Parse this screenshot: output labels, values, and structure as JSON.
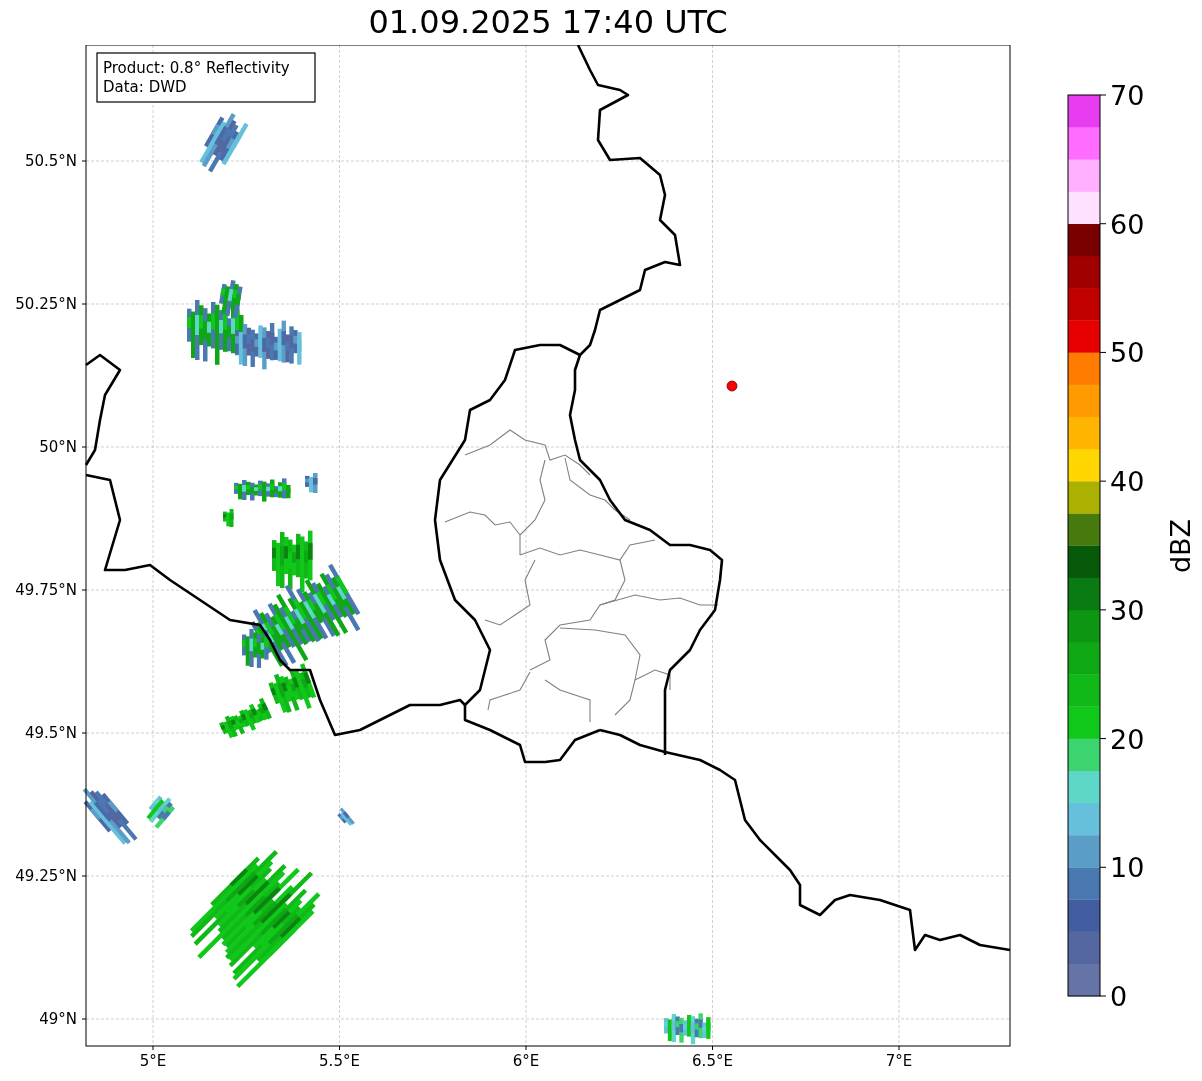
{
  "title": "01.09.2025 17:40 UTC",
  "info_box": [
    "Product: 0.8° Reflectivity",
    "Data: DWD"
  ],
  "map": {
    "lat_ticks": [
      "50.5°N",
      "50.25°N",
      "50°N",
      "49.75°N",
      "49.5°N",
      "49.25°N",
      "49°N"
    ],
    "lon_ticks": [
      "5°E",
      "5.5°E",
      "6°E",
      "6.5°E",
      "7°E"
    ]
  },
  "colorbar": {
    "label": "dBZ",
    "ticks": [
      "70",
      "60",
      "50",
      "40",
      "30",
      "20",
      "10",
      "0"
    ],
    "steps": [
      {
        "color": "#6573a6"
      },
      {
        "color": "#5567a0"
      },
      {
        "color": "#425ea0"
      },
      {
        "color": "#4a78b0"
      },
      {
        "color": "#5a9ec8"
      },
      {
        "color": "#66c0dc"
      },
      {
        "color": "#5ed6c8"
      },
      {
        "color": "#3cd46e"
      },
      {
        "color": "#10c81a"
      },
      {
        "color": "#10b818"
      },
      {
        "color": "#0ea814"
      },
      {
        "color": "#0c9612"
      },
      {
        "color": "#0a7a12"
      },
      {
        "color": "#065a0a"
      },
      {
        "color": "#467a0c"
      },
      {
        "color": "#acb000"
      },
      {
        "color": "#ffd600"
      },
      {
        "color": "#ffb400"
      },
      {
        "color": "#ff9a00"
      },
      {
        "color": "#ff7c00"
      },
      {
        "color": "#e60000"
      },
      {
        "color": "#c20000"
      },
      {
        "color": "#a00000"
      },
      {
        "color": "#780000"
      },
      {
        "color": "#ffe0ff"
      },
      {
        "color": "#ffb0ff"
      },
      {
        "color": "#ff6cff"
      },
      {
        "color": "#e83cf0"
      }
    ]
  }
}
